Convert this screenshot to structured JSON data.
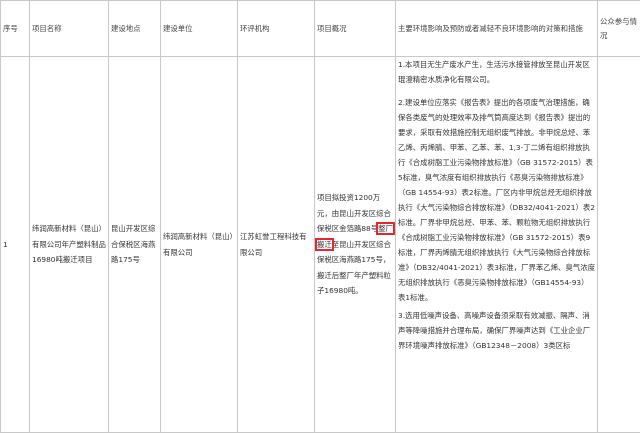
{
  "headers": {
    "seq": "序号",
    "name": "项目名称",
    "location": "建设地点",
    "unit": "建设单位",
    "agency": "环评机构",
    "summary": "项目概况",
    "measures": "主要环境影响及预防或者减轻不良环境影响的对策和措施",
    "publicity": "公众参与情况"
  },
  "row": {
    "seq": "1",
    "name": "纬润高新材料（昆山）有限公司年产塑料制品16980吨搬迁项目",
    "location": "昆山开发区综合保税区海燕路175号",
    "unit": "纬润高新材料（昆山）有限公司",
    "agency": "江苏虹誉工程科技有限公司",
    "summary_before": "项目拟投资1200万元，由昆山开发区综合保税区金箔路88号",
    "summary_highlight": "整厂搬迁",
    "summary_after": "至昆山开发区综合保税区海燕路175号，搬迁后整厂年产塑料粒子16980吨。",
    "measures": [
      "1.本项目无生产废水产生，生活污水接管排放至昆山开发区琨澄精密水质净化有限公司。",
      "2.建设单位应落实《报告表》提出的各项废气治理措施，确保各类废气的处理效率及排气筒高度达到《报告表》提出的要求，采取有效措施控制无组织废气排放。非甲烷总烃、苯乙烯、丙烯腈、甲苯、乙苯、苯、1,3-丁二烯有组织排放执行《合成树脂工业污染物排放标准》（GB 31572-2015）表5标准，臭气浓度有组织排放执行《恶臭污染物排放标准》（GB 14554-93）表2标准。厂区内非甲烷总烃无组织排放执行《大气污染物综合排放标准》（DB32/4041-2021）表2标准。厂界非甲烷总烃、甲苯、苯、颗粒物无组织排放执行《合成树脂工业污染物排放标准》（GB 31572-2015）表9标准，厂界丙烯腈无组织排放执行《大气污染物综合排放标准》（DB32/4041-2021）表3标准，厂界苯乙烯、臭气浓度无组织排放执行《恶臭污染物排放标准》（GB14554-93）表1标准。",
      "3.选用低噪声设备、高噪声设备须采取有效减振、隔声、消声等降噪措施并合理布局，确保厂界噪声达到《工业企业厂界环境噪声排放标准》（GB12348－2008）3类区标"
    ],
    "publicity": ""
  }
}
